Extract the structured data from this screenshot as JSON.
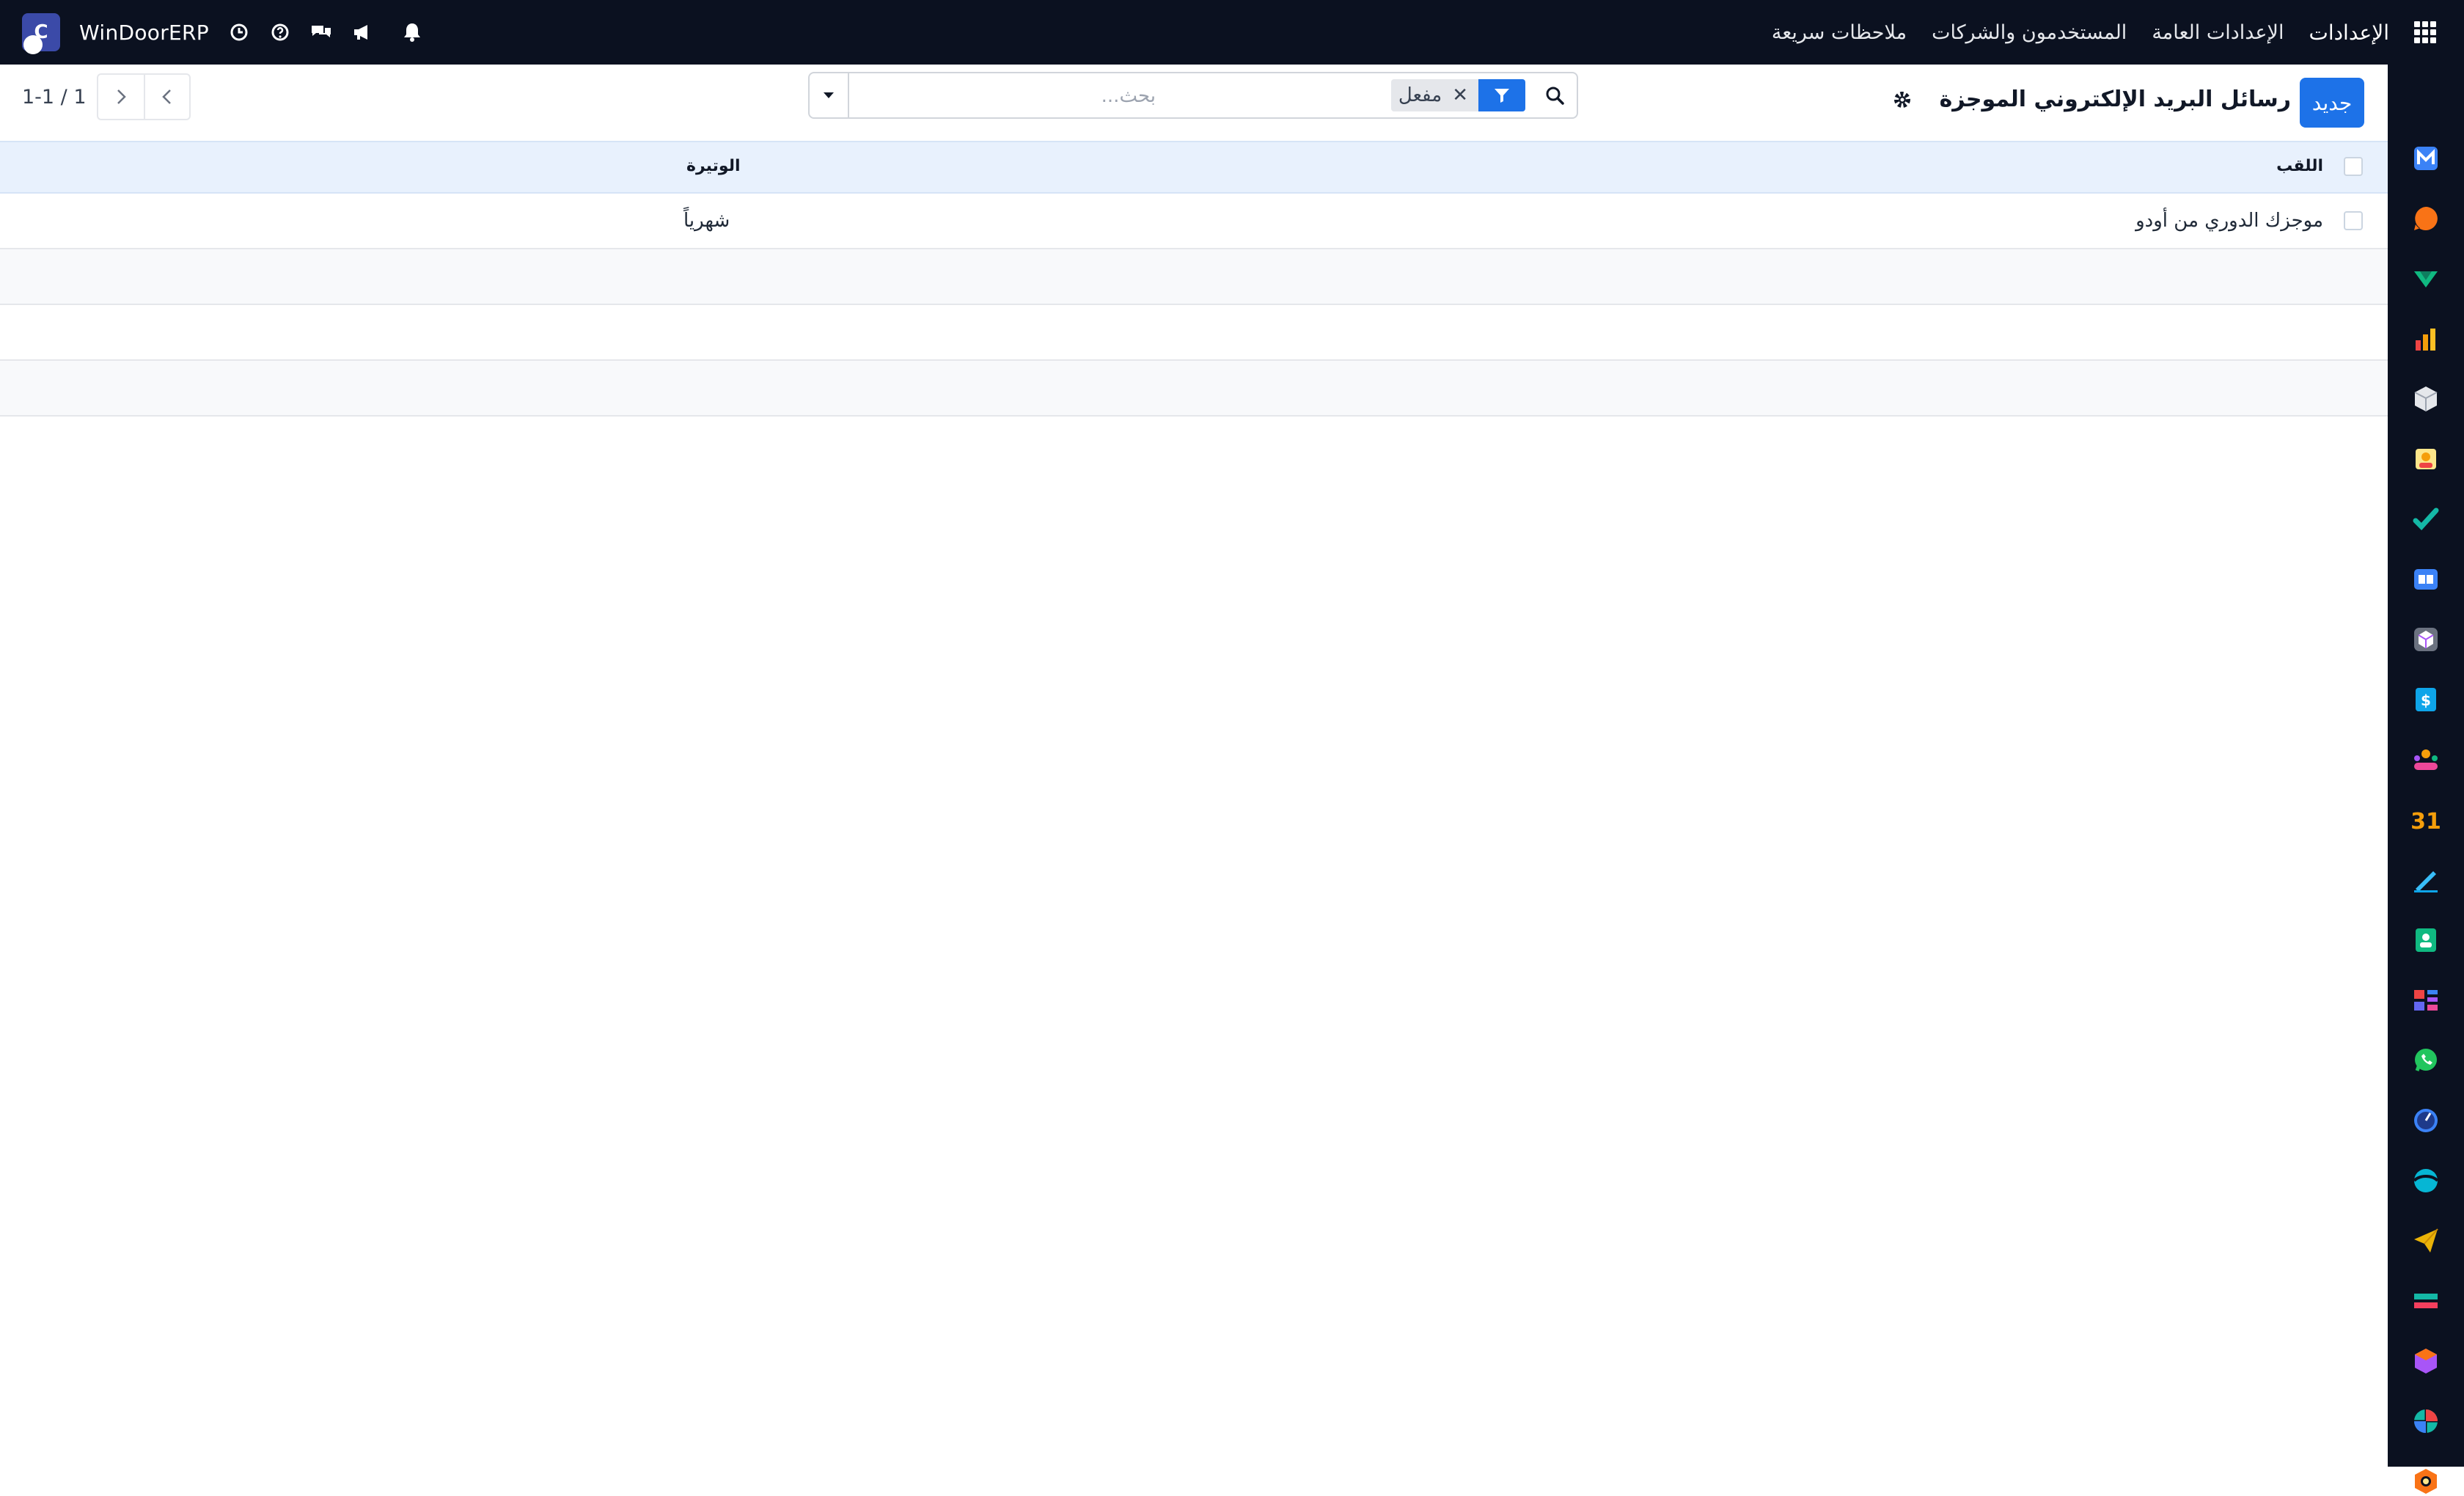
{
  "navbar": {
    "app_name": "الإعدادات",
    "menu": [
      "الإعدادات العامة",
      "المستخدمون والشركات",
      "ملاحظات سريعة"
    ],
    "company": "WinDoorERP",
    "avatar_letter": "C"
  },
  "control_panel": {
    "new_button": "جديد",
    "title": "رسائل البريد الإلكتروني الموجزة",
    "search": {
      "facet_value": "مفعل",
      "placeholder": "بحث..."
    },
    "pager": "1-1 / 1"
  },
  "table": {
    "columns": [
      "اللقب",
      "الوتيرة"
    ],
    "rows": [
      {
        "title": "موجزك الدوري من أودو",
        "frequency": "شهرياً"
      }
    ]
  },
  "sidebar_apps": [
    {
      "name": "mail-app-icon",
      "color": "#3b82f6"
    },
    {
      "name": "discuss-app-icon",
      "color": "#f97316"
    },
    {
      "name": "sales-app-icon",
      "color": "#10b981"
    },
    {
      "name": "reporting-app-icon",
      "color": "#f59e0b"
    },
    {
      "name": "inventory-app-icon",
      "color": "#e5e7eb"
    },
    {
      "name": "employees-app-icon",
      "color": "#f59e0b"
    },
    {
      "name": "todo-app-icon",
      "color": "#14b8a6"
    },
    {
      "name": "knowledge-app-icon",
      "color": "#3b82f6"
    },
    {
      "name": "packages-app-icon",
      "color": "#a855f7"
    },
    {
      "name": "invoicing-app-icon",
      "color": "#0ea5e9"
    },
    {
      "name": "contacts-team-app-icon",
      "color": "#ec4899"
    },
    {
      "name": "calendar-app-icon",
      "color": "#f59e0b"
    },
    {
      "name": "sign-app-icon",
      "color": "#38bdf8"
    },
    {
      "name": "contacts-app-icon",
      "color": "#10b981"
    },
    {
      "name": "dashboard-app-icon",
      "color": "#ef4444"
    },
    {
      "name": "whatsapp-app-icon",
      "color": "#22c55e"
    },
    {
      "name": "time-off-app-icon",
      "color": "#3b82f6"
    },
    {
      "name": "website-app-icon",
      "color": "#06b6d4"
    },
    {
      "name": "email-marketing-app-icon",
      "color": "#eab308"
    },
    {
      "name": "accounting-app-icon",
      "color": "#f43f5e"
    },
    {
      "name": "apps-store-icon",
      "color": "#a855f7"
    },
    {
      "name": "surveys-app-icon",
      "color": "#14b8a6"
    },
    {
      "name": "settings-app-icon",
      "color": "#f97316"
    }
  ]
}
